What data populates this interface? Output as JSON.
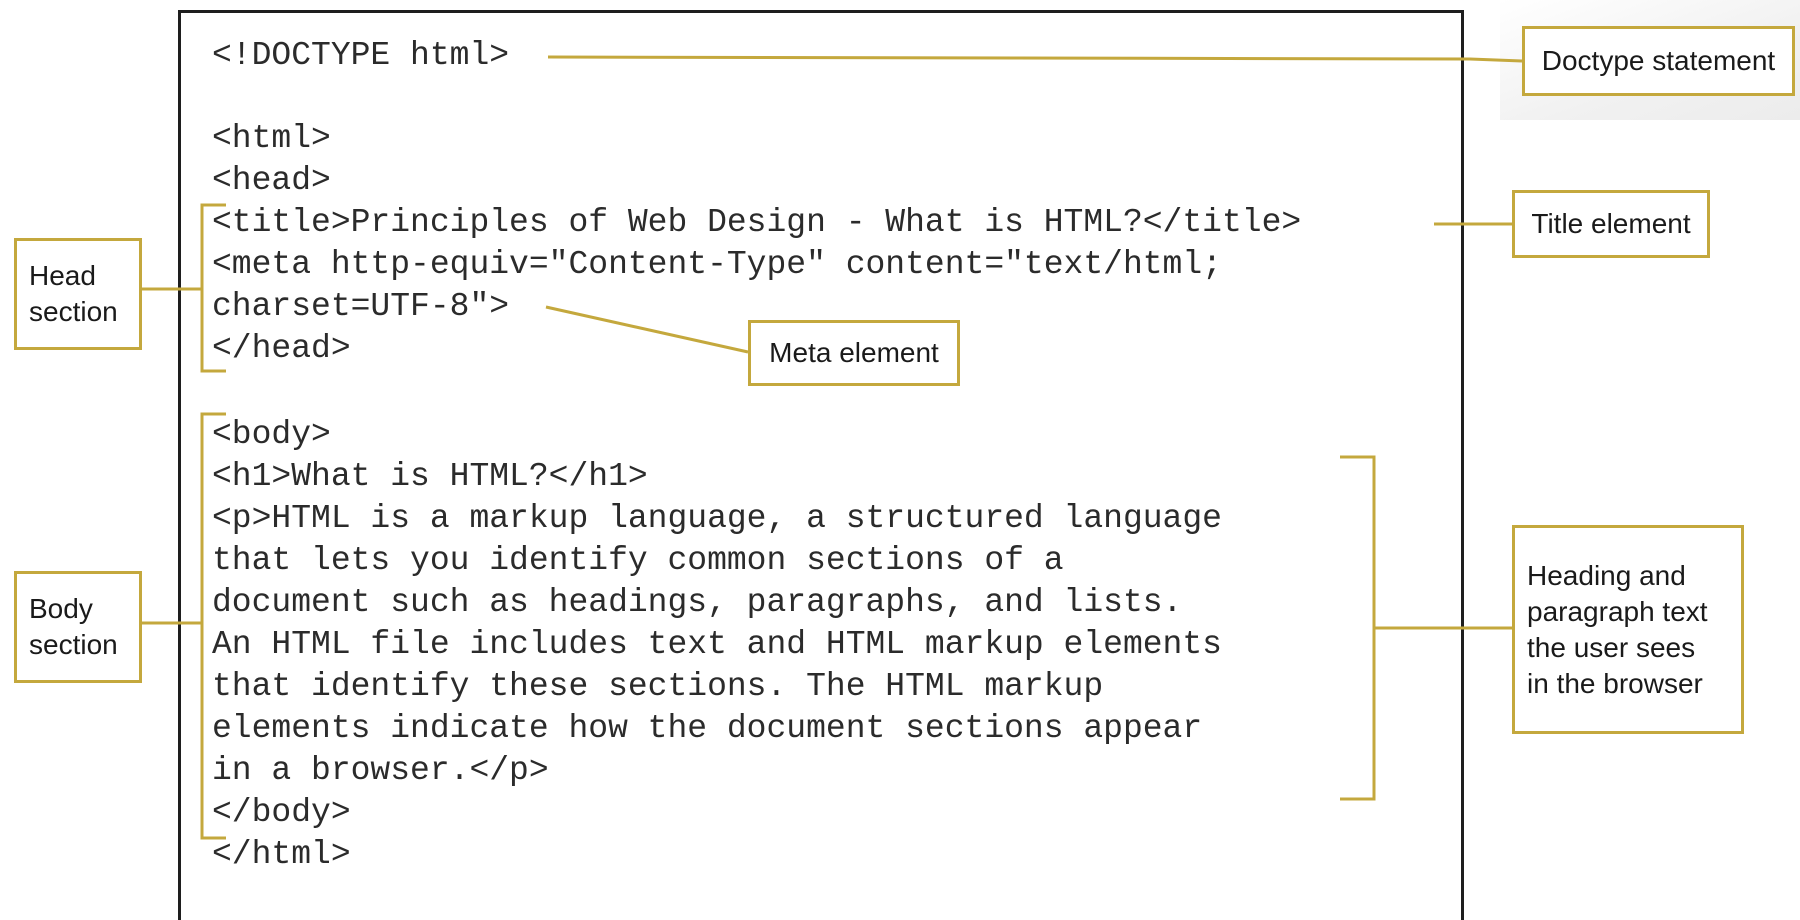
{
  "code": {
    "lines": [
      "<!DOCTYPE html>",
      "",
      "<html>",
      "<head>",
      "<title>Principles of Web Design - What is HTML?</title>",
      "<meta http-equiv=\"Content-Type\" content=\"text/html;",
      "charset=UTF-8\">",
      "</head>",
      "",
      "<body>",
      "<h1>What is HTML?</h1>",
      "<p>HTML is a markup language, a structured language",
      "that lets you identify common sections of a",
      "document such as headings, paragraphs, and lists.",
      "An HTML file includes text and HTML markup elements",
      "that identify these sections. The HTML markup",
      "elements indicate how the document sections appear",
      "in a browser.</p>",
      "</body>",
      "</html>"
    ]
  },
  "callouts": {
    "doctype": "Doctype statement",
    "title": "Title element",
    "meta": "Meta element",
    "head_line1": "Head",
    "head_line2": "section",
    "body_line1": "Body",
    "body_line2": "section",
    "text_line1": "Heading and",
    "text_line2": "paragraph text",
    "text_line3": "the user sees",
    "text_line4": "in the browser"
  },
  "colors": {
    "callout_border": "#c4a83d",
    "code_text": "#2b2b2b",
    "frame": "#1e1e1e"
  }
}
